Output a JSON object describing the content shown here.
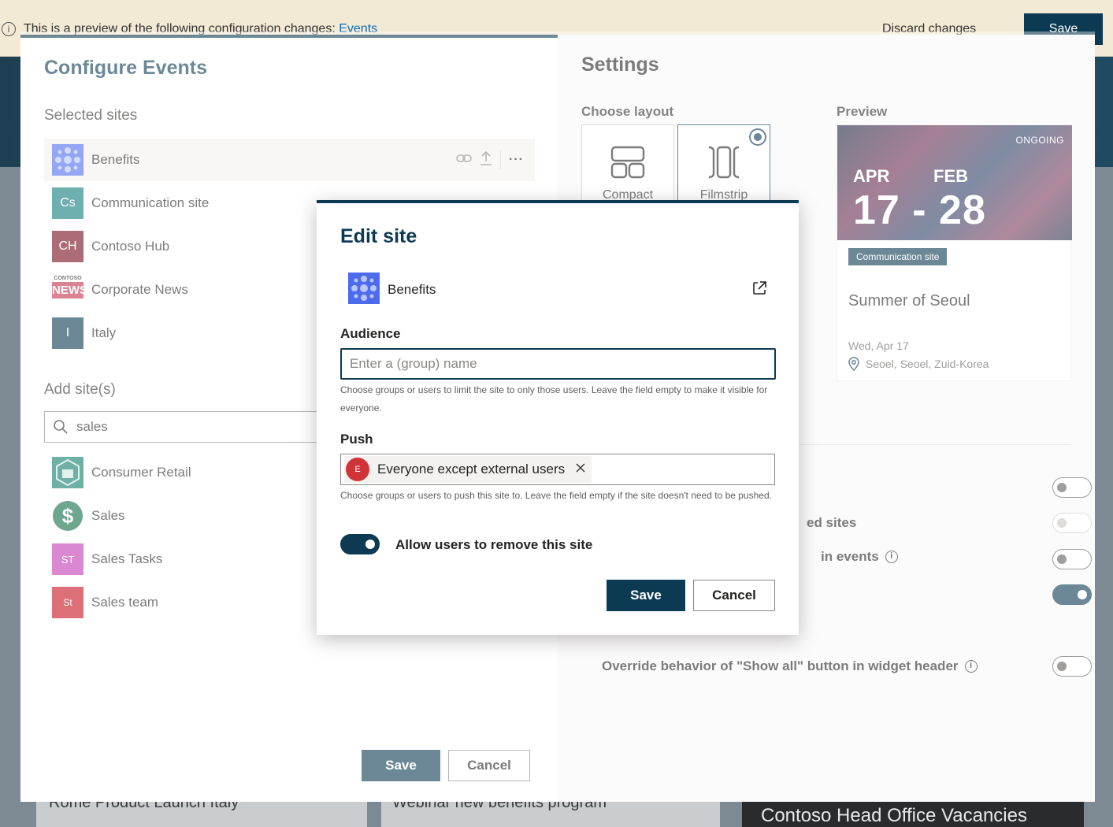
{
  "banner": {
    "message": "This is a preview of the following configuration changes:",
    "link": "Events",
    "discard_label": "Discard changes",
    "save_label": "Save"
  },
  "background": {
    "bottom_left": "Rome Product Launch Italy",
    "bottom_middle": "Webinar new benefits program",
    "bottom_right": "Contoso Head Office Vacancies"
  },
  "configure": {
    "title": "Configure Events",
    "selected_sites_label": "Selected sites",
    "selected_sites": [
      {
        "name": "Benefits",
        "icon_text": "",
        "icon": "benefits-logo",
        "color": "#4f6bed"
      },
      {
        "name": "Communication site",
        "icon_text": "Cs",
        "icon": "initials",
        "color": "#0e7c7b"
      },
      {
        "name": "Contoso Hub",
        "icon_text": "CH",
        "icon": "initials",
        "color": "#750b1c"
      },
      {
        "name": "Corporate News",
        "icon_text": "NEWS",
        "icon_subtext": "CONTOSO",
        "icon": "news-logo",
        "color": "#c4314b"
      },
      {
        "name": "Italy",
        "icon_text": "I",
        "icon": "initials",
        "color": "#0b3a52"
      }
    ],
    "add_sites_label": "Add site(s)",
    "search_value": "sales",
    "search_results": [
      {
        "name": "Consumer Retail",
        "icon_text": "",
        "icon": "retail-logo",
        "color": "#107c6b"
      },
      {
        "name": "Sales",
        "icon_text": "$",
        "icon": "dollar-logo",
        "color": "#0e6b44"
      },
      {
        "name": "Sales Tasks",
        "icon_text": "ST",
        "icon": "initials",
        "color": "#c239b3"
      },
      {
        "name": "Sales team",
        "icon_text": "St",
        "icon": "initials",
        "color": "#c50f1f"
      }
    ],
    "save_label": "Save",
    "cancel_label": "Cancel"
  },
  "settings": {
    "title": "Settings",
    "choose_layout_label": "Choose layout",
    "layouts": [
      "Compact",
      "Filmstrip"
    ],
    "selected_layout": "Filmstrip",
    "preview_label": "Preview",
    "preview": {
      "status": "ONGOING",
      "start_month": "APR",
      "end_month": "FEB",
      "days": "17 - 28",
      "badge": "Communication site",
      "title": "Summer of Seoul",
      "date": "Wed, Apr 17",
      "location": "Seoel, Seoel, Zuid-Korea"
    },
    "toggles": [
      {
        "label": "",
        "on": false,
        "disabled": false
      },
      {
        "label": "ed sites",
        "on": false,
        "disabled": true
      },
      {
        "label": "in events",
        "on": false,
        "disabled": false,
        "info": true
      },
      {
        "label": "",
        "on": true,
        "disabled": false
      },
      {
        "label": "Override behavior of \"Show all\" button in widget header",
        "on": false,
        "disabled": false,
        "info": true
      }
    ]
  },
  "modal": {
    "title": "Edit site",
    "site_name": "Benefits",
    "audience_label": "Audience",
    "audience_placeholder": "Enter a (group) name",
    "audience_help": "Choose groups or users to limit the site to only those users. Leave the field empty to make it visible for everyone.",
    "push_label": "Push",
    "push_chip": {
      "initial": "E",
      "label": "Everyone except external users"
    },
    "push_help": "Choose groups or users to push this site to. Leave the field empty if the site doesn't need to be pushed.",
    "allow_remove_label": "Allow users to remove this site",
    "allow_remove_on": true,
    "save_label": "Save",
    "cancel_label": "Cancel"
  }
}
